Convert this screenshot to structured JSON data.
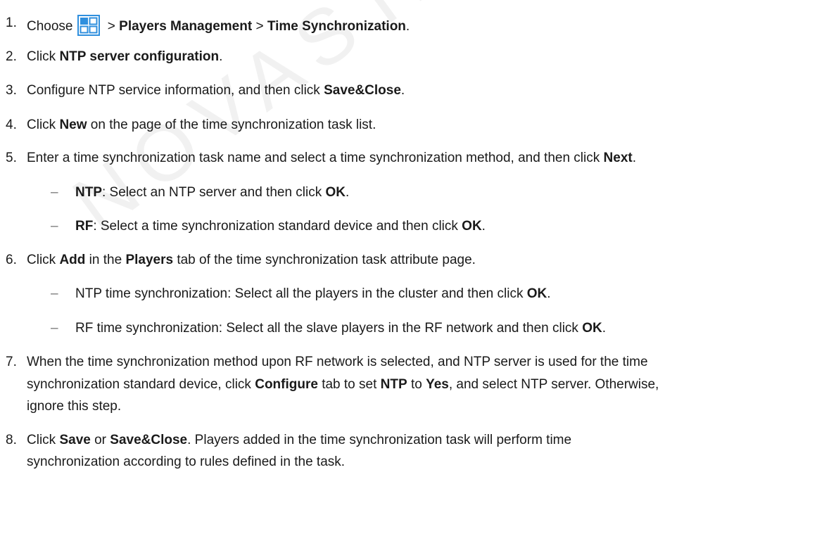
{
  "watermark": "NOVASTAR",
  "steps": {
    "s1": {
      "n": "1.",
      "a": "Choose",
      "b": " > ",
      "c": "Players Management",
      "d": " > ",
      "e": "Time Synchronization",
      "f": ".",
      "icon": "app-menu-icon"
    },
    "s2": {
      "n": "2.",
      "a": "Click ",
      "b": "NTP server configuration",
      "c": "."
    },
    "s3": {
      "n": "3.",
      "a": "Configure NTP service information, and then click ",
      "b": "Save&Close",
      "c": "."
    },
    "s4": {
      "n": "4.",
      "a": "Click ",
      "b": "New",
      "c": " on the page of the time synchronization task list."
    },
    "s5": {
      "n": "5.",
      "a": "Enter a time synchronization task name and select a time synchronization method, and then click ",
      "b": "Next",
      "c": "."
    },
    "s5a": {
      "dash": "–",
      "a": "NTP",
      "b": ": Select an NTP server and then click ",
      "c": "OK",
      "d": "."
    },
    "s5b": {
      "dash": "–",
      "a": "RF",
      "b": ": Select a time synchronization standard device and then click ",
      "c": "OK",
      "d": "."
    },
    "s6": {
      "n": "6.",
      "a": "Click ",
      "b": "Add",
      "c": " in the ",
      "d": "Players",
      "e": " tab of the time synchronization task attribute page."
    },
    "s6a": {
      "dash": "–",
      "a": "NTP time synchronization: Select all the players in the cluster and then click ",
      "b": "OK",
      "c": "."
    },
    "s6b": {
      "dash": "–",
      "a": "RF time synchronization: Select all the slave players in the RF network and then click ",
      "b": "OK",
      "c": "."
    },
    "s7": {
      "n": "7.",
      "l1": "When the time synchronization method upon RF network is selected, and NTP server is used for the time",
      "l2a": "synchronization standard device, click ",
      "l2b": "Configure",
      "l2c": " tab to set ",
      "l2d": "NTP",
      "l2e": " to ",
      "l2f": "Yes",
      "l2g": ", and select NTP server. Otherwise,",
      "l3": "ignore this step."
    },
    "s8": {
      "n": "8.",
      "l1a": "Click ",
      "l1b": "Save",
      "l1c": " or ",
      "l1d": "Save&Close",
      "l1e": ". Players added in the time synchronization task will perform time",
      "l2": "synchronization according to rules defined in the task."
    }
  },
  "colors": {
    "icon_blue": "#2f8fde",
    "text": "#1a1a1a"
  }
}
